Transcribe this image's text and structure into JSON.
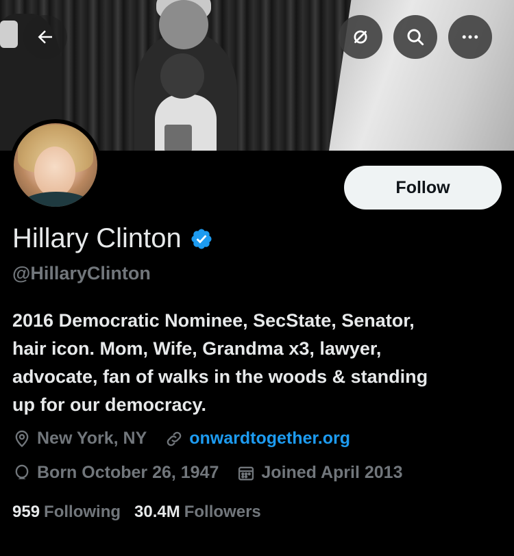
{
  "header": {
    "back_icon": "arrow-left-icon",
    "actions": [
      {
        "icon": "link-off-icon"
      },
      {
        "icon": "search-icon"
      },
      {
        "icon": "more-icon"
      }
    ]
  },
  "profile": {
    "name": "Hillary Clinton",
    "handle": "@HillaryClinton",
    "verified": true,
    "bio": "2016 Democratic Nominee, SecState, Senator,\nhair icon. Mom, Wife, Grandma x3, lawyer,\nadvocate, fan of walks in the woods & standing\nup for our democracy.",
    "location": "New York, NY",
    "website": "onwardtogether.org",
    "born": "Born October 26, 1947",
    "joined": "Joined April 2013",
    "following_count": "959",
    "following_label": "Following",
    "followers_count": "30.4M",
    "followers_label": "Followers"
  },
  "buttons": {
    "follow_label": "Follow"
  },
  "colors": {
    "background": "#000000",
    "text": "#e7e9ea",
    "muted": "#71767b",
    "link": "#1d9bf0",
    "verified": "#1d9bf0",
    "follow_bg": "#eff3f4"
  }
}
